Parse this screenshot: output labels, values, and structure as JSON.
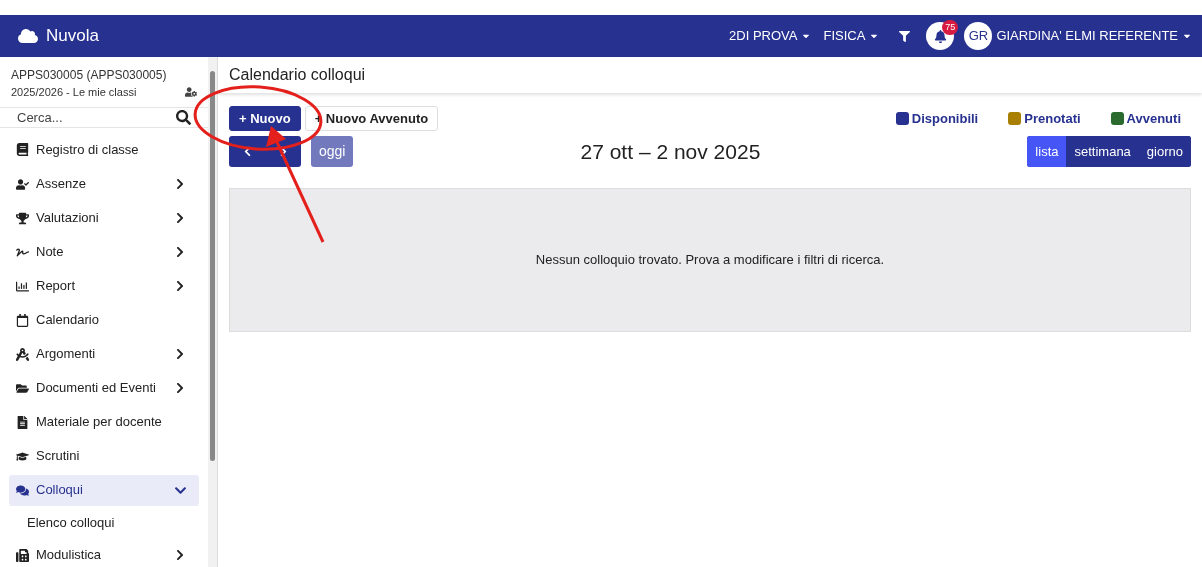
{
  "app": {
    "name": "Nuvola"
  },
  "header": {
    "menus": [
      {
        "label": "2DI PROVA"
      },
      {
        "label": "FISICA"
      }
    ],
    "notifications": "75",
    "user": {
      "initials": "GR",
      "name": "GIARDINA' ELMI REFERENTE"
    }
  },
  "sidebar": {
    "school": "APPS030005 (APPS030005)",
    "year": "2025/2026 - Le mie classi",
    "search": {
      "placeholder": "Cerca..."
    },
    "items": [
      {
        "label": "Registro di classe",
        "expandable": false,
        "expanded": false,
        "selected": false
      },
      {
        "label": "Assenze",
        "expandable": true,
        "expanded": false,
        "selected": false
      },
      {
        "label": "Valutazioni",
        "expandable": true,
        "expanded": false,
        "selected": false
      },
      {
        "label": "Note",
        "expandable": true,
        "expanded": false,
        "selected": false
      },
      {
        "label": "Report",
        "expandable": true,
        "expanded": false,
        "selected": false
      },
      {
        "label": "Calendario",
        "expandable": false,
        "expanded": false,
        "selected": false
      },
      {
        "label": "Argomenti",
        "expandable": true,
        "expanded": false,
        "selected": false
      },
      {
        "label": "Documenti ed Eventi",
        "expandable": true,
        "expanded": false,
        "selected": false
      },
      {
        "label": "Materiale per docente",
        "expandable": false,
        "expanded": false,
        "selected": false
      },
      {
        "label": "Scrutini",
        "expandable": false,
        "expanded": false,
        "selected": false
      },
      {
        "label": "Colloqui",
        "expandable": true,
        "expanded": true,
        "selected": true,
        "children": [
          {
            "label": "Elenco colloqui"
          }
        ]
      },
      {
        "label": "Modulistica",
        "expandable": true,
        "expanded": false,
        "selected": false
      }
    ]
  },
  "page": {
    "title": "Calendario colloqui",
    "actions": [
      {
        "label": "+ Nuovo",
        "kind": "primary"
      },
      {
        "label": "+ Nuovo Avvenuto",
        "kind": "outline"
      }
    ],
    "legend": [
      {
        "label": "Disponibili",
        "color": "#27318f"
      },
      {
        "label": "Prenotati",
        "color": "#a87f00"
      },
      {
        "label": "Avvenuti",
        "color": "#2a6a2e"
      }
    ],
    "today": "oggi",
    "range": "27 ott – 2 nov 2025",
    "views": [
      {
        "label": "lista",
        "selected": true
      },
      {
        "label": "settimana",
        "selected": false
      },
      {
        "label": "giorno",
        "selected": false
      }
    ],
    "empty": "Nessun colloquio trovato. Prova a modificare i filtri di ricerca."
  }
}
